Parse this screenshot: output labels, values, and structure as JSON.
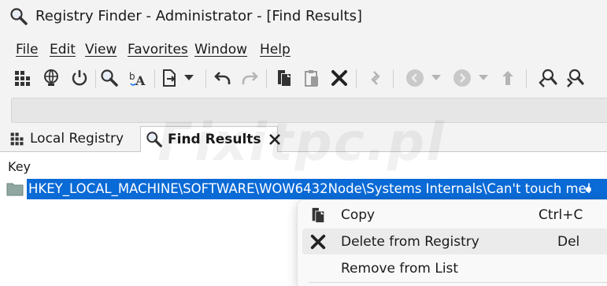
{
  "window": {
    "title": "Registry Finder - Administrator - [Find Results]",
    "app_icon": "magnifier-icon"
  },
  "menubar": {
    "items": [
      "File",
      "Edit",
      "View",
      "Favorites",
      "Window",
      "Help"
    ]
  },
  "toolbar": {
    "buttons": [
      "registry-grid-icon",
      "network-registry-icon",
      "power-icon",
      "find-icon",
      "replace-icon",
      "export-icon",
      "dropdown-arrow-icon",
      "undo-icon",
      "redo-icon",
      "copy-icon",
      "paste-icon",
      "delete-icon",
      "refresh-icon",
      "back-icon",
      "forward-icon",
      "up-icon",
      "find-previous-icon",
      "find-next-icon"
    ]
  },
  "address_bar": {
    "value": ""
  },
  "tabs": [
    {
      "label": "Local Registry",
      "icon": "registry-grid-icon",
      "active": false
    },
    {
      "label": "Find Results",
      "icon": "magnifier-icon",
      "active": true,
      "close_icon": "close-icon"
    }
  ],
  "watermark": "Fixitpc.pl",
  "results": {
    "column_header": "Key",
    "rows": [
      {
        "icon": "folder-icon",
        "key": "HKEY_LOCAL_MACHINE\\SOFTWARE\\WOW6432Node\\Systems Internals\\Can't touch me!",
        "selected": true
      }
    ]
  },
  "context_menu": {
    "items": [
      {
        "label": "Copy",
        "shortcut": "Ctrl+C",
        "icon": "copy-icon"
      },
      {
        "label": "Delete from Registry",
        "shortcut": "Del",
        "icon": "delete-icon",
        "hover": true
      },
      {
        "label": "Remove from List",
        "shortcut": "",
        "icon": ""
      }
    ]
  },
  "colors": {
    "selection": "#0a6ad6",
    "chrome_background": "#f3f3f3",
    "menu_background": "#f9f9f9"
  }
}
